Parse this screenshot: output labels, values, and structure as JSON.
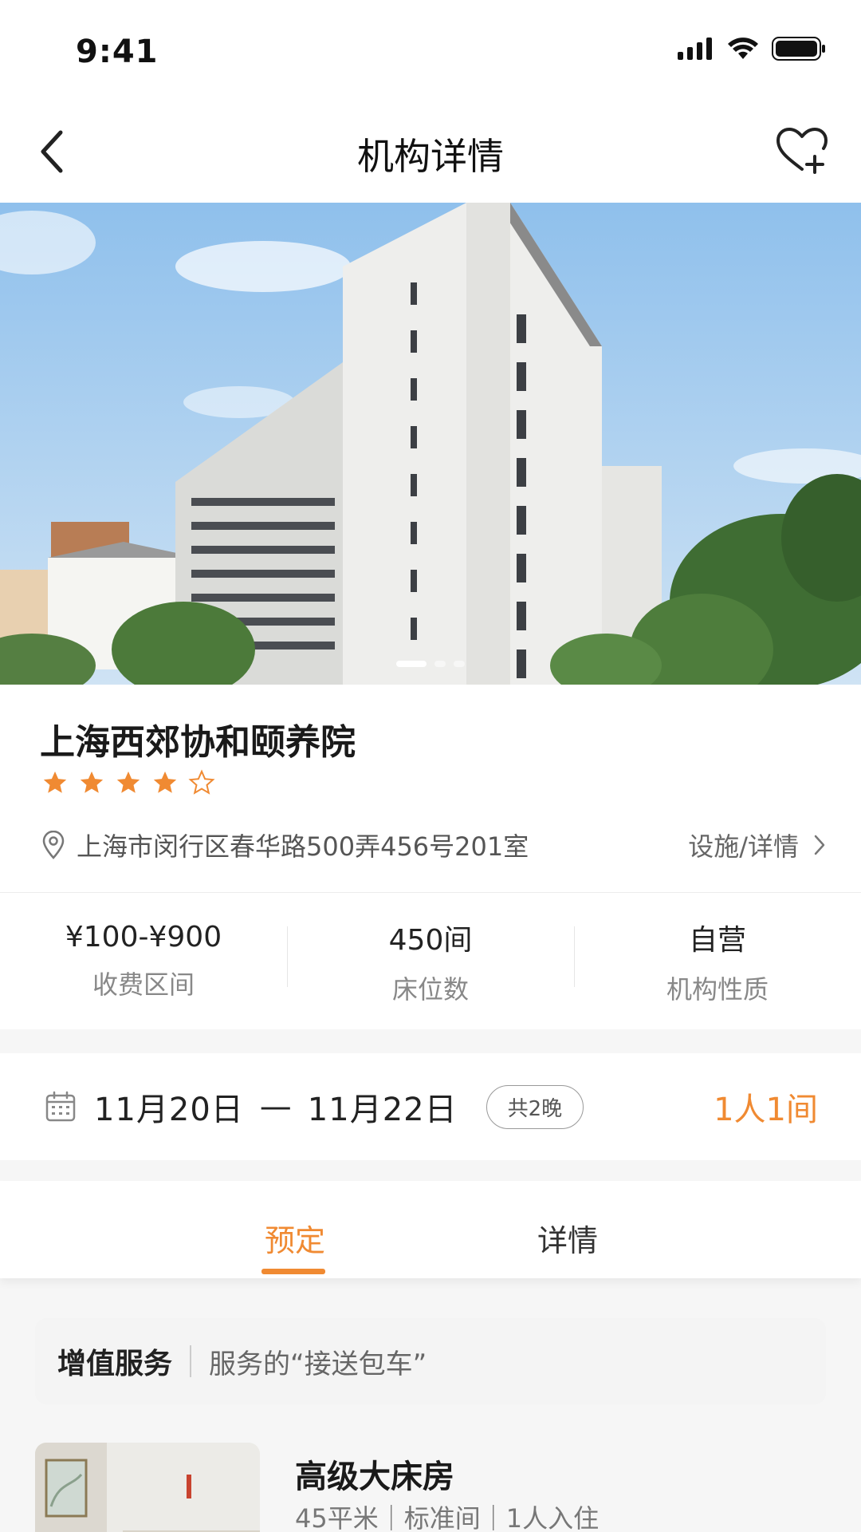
{
  "status": {
    "time": "9:41"
  },
  "nav": {
    "title": "机构详情"
  },
  "hero": {
    "slide_count": 3,
    "active_slide": 1
  },
  "org": {
    "name": "上海西郊协和颐养院",
    "rating": 4,
    "rating_max": 5,
    "address": "上海市闵行区春华路500弄456号201室",
    "facility_link": "设施/详情"
  },
  "stats": [
    {
      "value": "¥100-¥900",
      "label": "收费区间"
    },
    {
      "value": "450间",
      "label": "床位数"
    },
    {
      "value": "自营",
      "label": "机构性质"
    }
  ],
  "booking": {
    "start_date": "11月20日",
    "separator": "—",
    "end_date": "11月22日",
    "nights": "共2晚",
    "guests": "1人1间"
  },
  "tabs": {
    "book": "预定",
    "detail": "详情",
    "active": "book"
  },
  "value_added": {
    "title": "增值服务",
    "desc": "服务的“接送包车”"
  },
  "room": {
    "name": "高级大床房",
    "meta": "45平米｜标准间｜1人入住"
  },
  "colors": {
    "accent": "#f08a32",
    "star": "#f08a32"
  }
}
